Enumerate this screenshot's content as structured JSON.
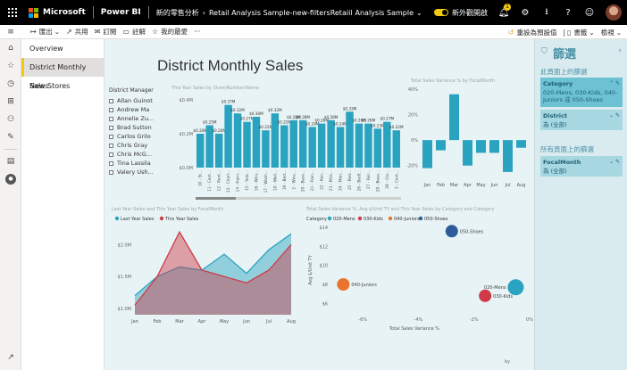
{
  "topbar": {
    "brand": "Microsoft",
    "app": "Power BI",
    "workspace": "新的零售分析",
    "report": "Retail Analysis Sample-new-filtersRetaiil",
    "report_menu": "Analysis Sample",
    "toggle_label": "新外觀開啟",
    "notif_count": "1"
  },
  "cmdbar": {
    "export": "匯出",
    "share": "共用",
    "subscribe": "訂閱",
    "comment": "註解",
    "favorite": "我的最愛",
    "reset": "重設為預設值",
    "bookmarks": "書籤",
    "view": "檢視"
  },
  "pages": [
    {
      "label": "Overview",
      "active": false
    },
    {
      "label": "District Monthly Sales",
      "active": true
    },
    {
      "label": "New Stores",
      "active": false
    }
  ],
  "report": {
    "title": "District Monthly Sales",
    "slicer": {
      "title": "District Manager",
      "items": [
        "Allan Guinot",
        "Andrew Ma",
        "Annelie Zu...",
        "Brad Sutton",
        "Carlos Grilo",
        "Chris Gray",
        "Chris McG...",
        "Tina Lassila",
        "Valery Ush..."
      ]
    },
    "bar_title": "This Year Sales by Store/Number/Name",
    "var_title": "Total Sales Variance % by FocalMonth",
    "area_title": "Last Year Sales and This Year Sales by FocalMonth",
    "scatter_title": "Total Sales Variance %, Avg $/Unit TY and This Year Sales by Category and Category",
    "scatter_legend_label": "Category",
    "footer": "by"
  },
  "chart_data": [
    {
      "type": "bar",
      "title": "This Year Sales by Store/Number/Name",
      "categories": [
        "10 - St...",
        "11 - Cent...",
        "12 - Kent...",
        "13 - Charl...",
        "14 - Harri...",
        "15 - York...",
        "16 - Wini...",
        "17 - Wash...",
        "18 - Well...",
        "19 - Bed...",
        "2 - Winc...",
        "20 - Beav...",
        "21 - Fren...",
        "22 - Ken...",
        "23 - Pitts...",
        "24 - Mon...",
        "25 - Red...",
        "26 - Bedf...",
        "27 - Fair...",
        "28 - Beav...",
        "29 - Cla...",
        "3 - Cont..."
      ],
      "values": [
        0.2,
        0.25,
        0.2,
        0.37,
        0.32,
        0.27,
        0.3,
        0.22,
        0.32,
        0.25,
        0.28,
        0.28,
        0.24,
        0.26,
        0.28,
        0.24,
        0.33,
        0.26,
        0.26,
        0.23,
        0.27,
        0.22
      ],
      "labels": [
        "$0.20M",
        "$0.25M",
        "$0.20M",
        "$0.37M",
        "$0.32M",
        "$0.27M",
        "$0.30M",
        "$0.22M",
        "$0.32M",
        "$0.25M",
        "$0.28M",
        "$0.28M",
        "$0.24M",
        "$0.26M",
        "$0.28M",
        "$0.24M",
        "$0.33M",
        "$0.26M",
        "$0.26M",
        "$0.23M",
        "$0.27M",
        "$0.22M"
      ],
      "yticks": [
        "$0.4M",
        "$0.2M",
        "$0.0M"
      ],
      "ylim": [
        0,
        0.4
      ],
      "color": "#2aa3c0"
    },
    {
      "type": "bar",
      "title": "Total Sales Variance % by FocalMonth",
      "categories": [
        "Jan",
        "Feb",
        "Mar",
        "Apr",
        "May",
        "Jun",
        "Jul",
        "Aug"
      ],
      "values": [
        -22,
        -8,
        36,
        -20,
        -10,
        -10,
        -25,
        -6
      ],
      "yticks": [
        "40%",
        "20%",
        "0%",
        "-20%"
      ],
      "ylim": [
        -30,
        40
      ],
      "color": "#2aa3c0"
    },
    {
      "type": "area",
      "title": "Last Year Sales and This Year Sales by FocalMonth",
      "categories": [
        "Jan",
        "Feb",
        "Mar",
        "Apr",
        "May",
        "Jun",
        "Jul",
        "Aug"
      ],
      "series": [
        {
          "name": "Last Year Sales",
          "values": [
            1.2,
            1.5,
            1.65,
            1.6,
            1.85,
            1.55,
            1.92,
            2.17
          ],
          "color": "#2aa3c0"
        },
        {
          "name": "This Year Sales",
          "values": [
            1.05,
            1.5,
            2.2,
            1.6,
            1.5,
            1.4,
            1.6,
            2.0
          ],
          "color": "#cf3a48"
        }
      ],
      "yticks": [
        "$2.0M",
        "$1.5M",
        "$1.0M"
      ],
      "ylim": [
        0.9,
        2.3
      ]
    },
    {
      "type": "scatter",
      "title": "Total Sales Variance %, Avg $/Unit TY and This Year Sales by Category and Category",
      "xlabel": "Total Sales Variance %",
      "ylabel": "Avg $/Unit TY",
      "xticks": [
        "-6%",
        "-4%",
        "-2%",
        "0%"
      ],
      "yticks": [
        "$14",
        "$12",
        "$10",
        "$8",
        "$6"
      ],
      "xlim": [
        -7,
        0
      ],
      "ylim": [
        5,
        14
      ],
      "series": [
        {
          "name": "020-Mens",
          "color": "#2aa3c0",
          "x": -0.5,
          "y": 7.7,
          "size": 9
        },
        {
          "name": "030-Kids",
          "color": "#cf3a48",
          "x": -1.6,
          "y": 6.8,
          "size": 7
        },
        {
          "name": "040-Juniors",
          "color": "#e8742f",
          "x": -6.7,
          "y": 8.0,
          "size": 7
        },
        {
          "name": "050-Shoes",
          "color": "#2d5c9a",
          "x": -2.8,
          "y": 13.6,
          "size": 7
        }
      ]
    }
  ],
  "filters": {
    "title": "篩選",
    "page_section": "此頁面上的篩選",
    "all_section": "所有頁面上的篩選",
    "cards": [
      {
        "title": "Category",
        "value": "020-Mens, 030-Kids, 040-Juniors 或 050-Shoes",
        "active": true
      },
      {
        "title": "District",
        "value": "為 (全部)",
        "active": false
      },
      {
        "title": "FocalMonth",
        "value": "為 (全部)",
        "active": false
      }
    ]
  },
  "colors": {
    "accent": "#f2c811",
    "teal": "#2aa3c0",
    "red": "#cf3a48",
    "filterpane": "#d9ebee"
  }
}
